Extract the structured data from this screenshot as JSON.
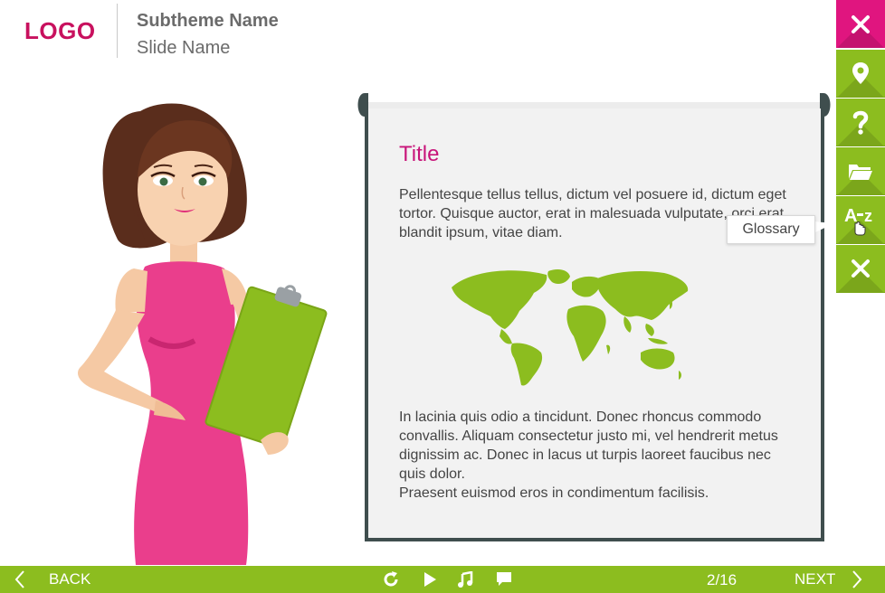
{
  "header": {
    "logo": "LOGO",
    "subtheme": "Subtheme Name",
    "slide_name": "Slide Name"
  },
  "panel": {
    "title": "Title",
    "paragraph1": "Pellentesque tellus tellus, dictum vel posuere id, dictum eget tortor. Quisque auctor, erat in malesuada vulputate, orci erat blandit ipsum, vitae diam.",
    "paragraph2": "In lacinia quis odio a tincidunt. Donec rhoncus commodo convallis. Aliquam consectetur justo mi, vel hendrerit metus dignissim ac. Donec in lacus ut turpis laoreet faucibus nec quis dolor.",
    "paragraph3": "Praesent euismod eros in condimentum facilisis."
  },
  "tooltip": {
    "label": "Glossary"
  },
  "sidebar": {
    "items": [
      {
        "icon": "close-icon",
        "color": "#e0157f"
      },
      {
        "icon": "location-pin-icon",
        "color": "#8cbd1f"
      },
      {
        "icon": "question-icon",
        "color": "#8cbd1f"
      },
      {
        "icon": "folder-icon",
        "color": "#8cbd1f"
      },
      {
        "icon": "glossary-az-icon",
        "label": "A-z",
        "color": "#8cbd1f"
      },
      {
        "icon": "close-icon",
        "color": "#8cbd1f"
      }
    ]
  },
  "footer": {
    "back_label": "BACK",
    "next_label": "NEXT",
    "page_counter": "2/16",
    "controls": [
      "replay-icon",
      "play-icon",
      "music-icon",
      "comment-icon"
    ]
  },
  "colors": {
    "accent_green": "#8cbd1f",
    "accent_pink": "#e0157f",
    "title_pink": "#c8157a",
    "panel_border": "#3f4e4e"
  }
}
